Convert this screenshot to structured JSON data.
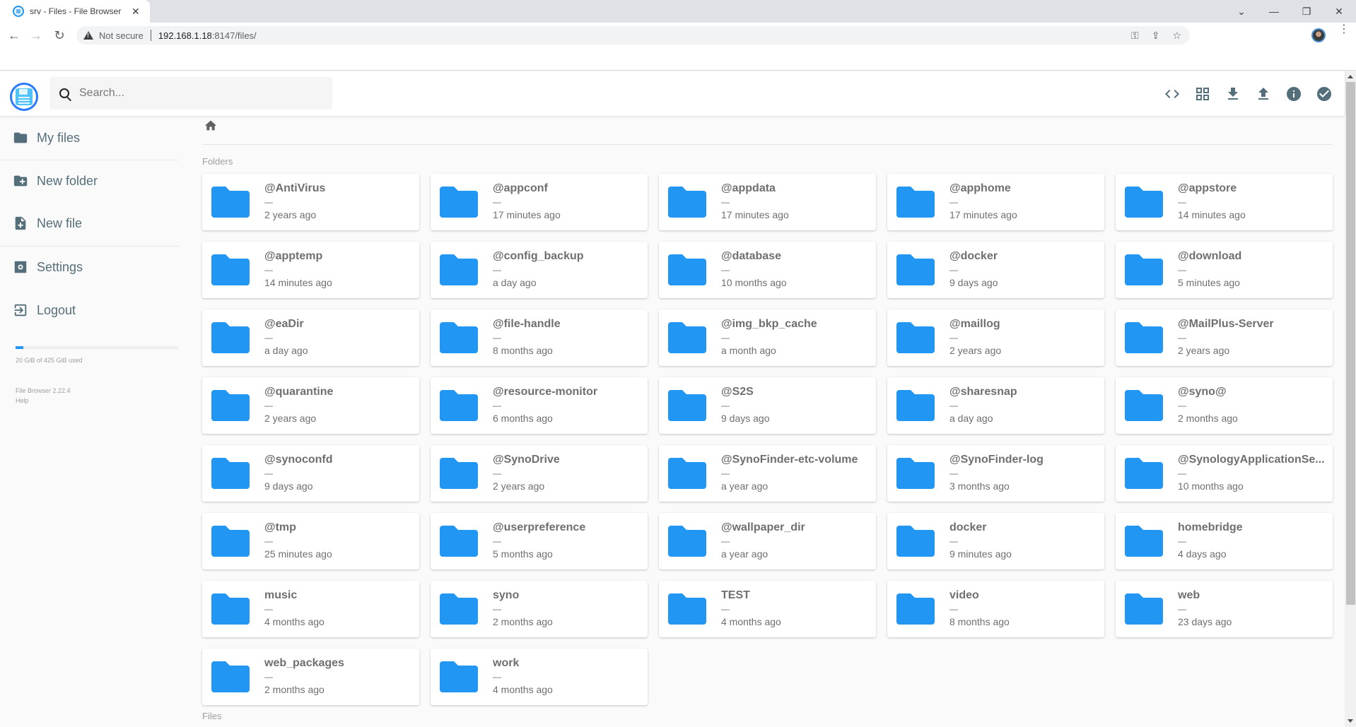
{
  "browser": {
    "tab_title": "srv - Files - File Browser",
    "not_secure_label": "Not secure",
    "url_host": "192.168.1.18",
    "url_rest": ":8147/files/"
  },
  "header": {
    "search_placeholder": "Search...",
    "actions": [
      {
        "name": "switch-view",
        "icon": "code-brackets-icon"
      },
      {
        "name": "grid-view",
        "icon": "grid-icon"
      },
      {
        "name": "download",
        "icon": "download-icon"
      },
      {
        "name": "upload",
        "icon": "upload-icon"
      },
      {
        "name": "info",
        "icon": "info-icon"
      },
      {
        "name": "select-multiple",
        "icon": "check-circle-icon"
      }
    ]
  },
  "sidebar": {
    "items": [
      {
        "label": "My files",
        "icon": "folder-icon"
      },
      {
        "label": "New folder",
        "icon": "create-new-folder-icon"
      },
      {
        "label": "New file",
        "icon": "note-add-icon"
      },
      {
        "label": "Settings",
        "icon": "settings-icon"
      },
      {
        "label": "Logout",
        "icon": "exit-icon"
      }
    ],
    "usage": {
      "used_fraction": 0.047,
      "label": "20 GiB of 425 GiB used"
    },
    "version": "File Browser 2.22.4",
    "help": "Help"
  },
  "content": {
    "folders_label": "Folders",
    "files_label": "Files",
    "folder_color": "#2196f3",
    "folders": [
      {
        "name": "@AntiVirus",
        "size": "—",
        "modified": "2 years ago"
      },
      {
        "name": "@appconf",
        "size": "—",
        "modified": "17 minutes ago"
      },
      {
        "name": "@appdata",
        "size": "—",
        "modified": "17 minutes ago"
      },
      {
        "name": "@apphome",
        "size": "—",
        "modified": "17 minutes ago"
      },
      {
        "name": "@appstore",
        "size": "—",
        "modified": "14 minutes ago"
      },
      {
        "name": "@apptemp",
        "size": "—",
        "modified": "14 minutes ago"
      },
      {
        "name": "@config_backup",
        "size": "—",
        "modified": "a day ago"
      },
      {
        "name": "@database",
        "size": "—",
        "modified": "10 months ago"
      },
      {
        "name": "@docker",
        "size": "—",
        "modified": "9 days ago"
      },
      {
        "name": "@download",
        "size": "—",
        "modified": "5 minutes ago"
      },
      {
        "name": "@eaDir",
        "size": "—",
        "modified": "a day ago"
      },
      {
        "name": "@file-handle",
        "size": "—",
        "modified": "8 months ago"
      },
      {
        "name": "@img_bkp_cache",
        "size": "—",
        "modified": "a month ago"
      },
      {
        "name": "@maillog",
        "size": "—",
        "modified": "2 years ago"
      },
      {
        "name": "@MailPlus-Server",
        "size": "—",
        "modified": "2 years ago"
      },
      {
        "name": "@quarantine",
        "size": "—",
        "modified": "2 years ago"
      },
      {
        "name": "@resource-monitor",
        "size": "—",
        "modified": "6 months ago"
      },
      {
        "name": "@S2S",
        "size": "—",
        "modified": "9 days ago"
      },
      {
        "name": "@sharesnap",
        "size": "—",
        "modified": "a day ago"
      },
      {
        "name": "@syno@",
        "size": "—",
        "modified": "2 months ago"
      },
      {
        "name": "@synoconfd",
        "size": "—",
        "modified": "9 days ago"
      },
      {
        "name": "@SynoDrive",
        "size": "—",
        "modified": "2 years ago"
      },
      {
        "name": "@SynoFinder-etc-volume",
        "size": "—",
        "modified": "a year ago"
      },
      {
        "name": "@SynoFinder-log",
        "size": "—",
        "modified": "3 months ago"
      },
      {
        "name": "@SynologyApplicationSe...",
        "size": "—",
        "modified": "10 months ago"
      },
      {
        "name": "@tmp",
        "size": "—",
        "modified": "25 minutes ago"
      },
      {
        "name": "@userpreference",
        "size": "—",
        "modified": "5 months ago"
      },
      {
        "name": "@wallpaper_dir",
        "size": "—",
        "modified": "a year ago"
      },
      {
        "name": "docker",
        "size": "—",
        "modified": "9 minutes ago"
      },
      {
        "name": "homebridge",
        "size": "—",
        "modified": "4 days ago"
      },
      {
        "name": "music",
        "size": "—",
        "modified": "4 months ago"
      },
      {
        "name": "syno",
        "size": "—",
        "modified": "2 months ago"
      },
      {
        "name": "TEST",
        "size": "—",
        "modified": "4 months ago"
      },
      {
        "name": "video",
        "size": "—",
        "modified": "8 months ago"
      },
      {
        "name": "web",
        "size": "—",
        "modified": "23 days ago"
      },
      {
        "name": "web_packages",
        "size": "—",
        "modified": "2 months ago"
      },
      {
        "name": "work",
        "size": "—",
        "modified": "4 months ago"
      }
    ]
  }
}
